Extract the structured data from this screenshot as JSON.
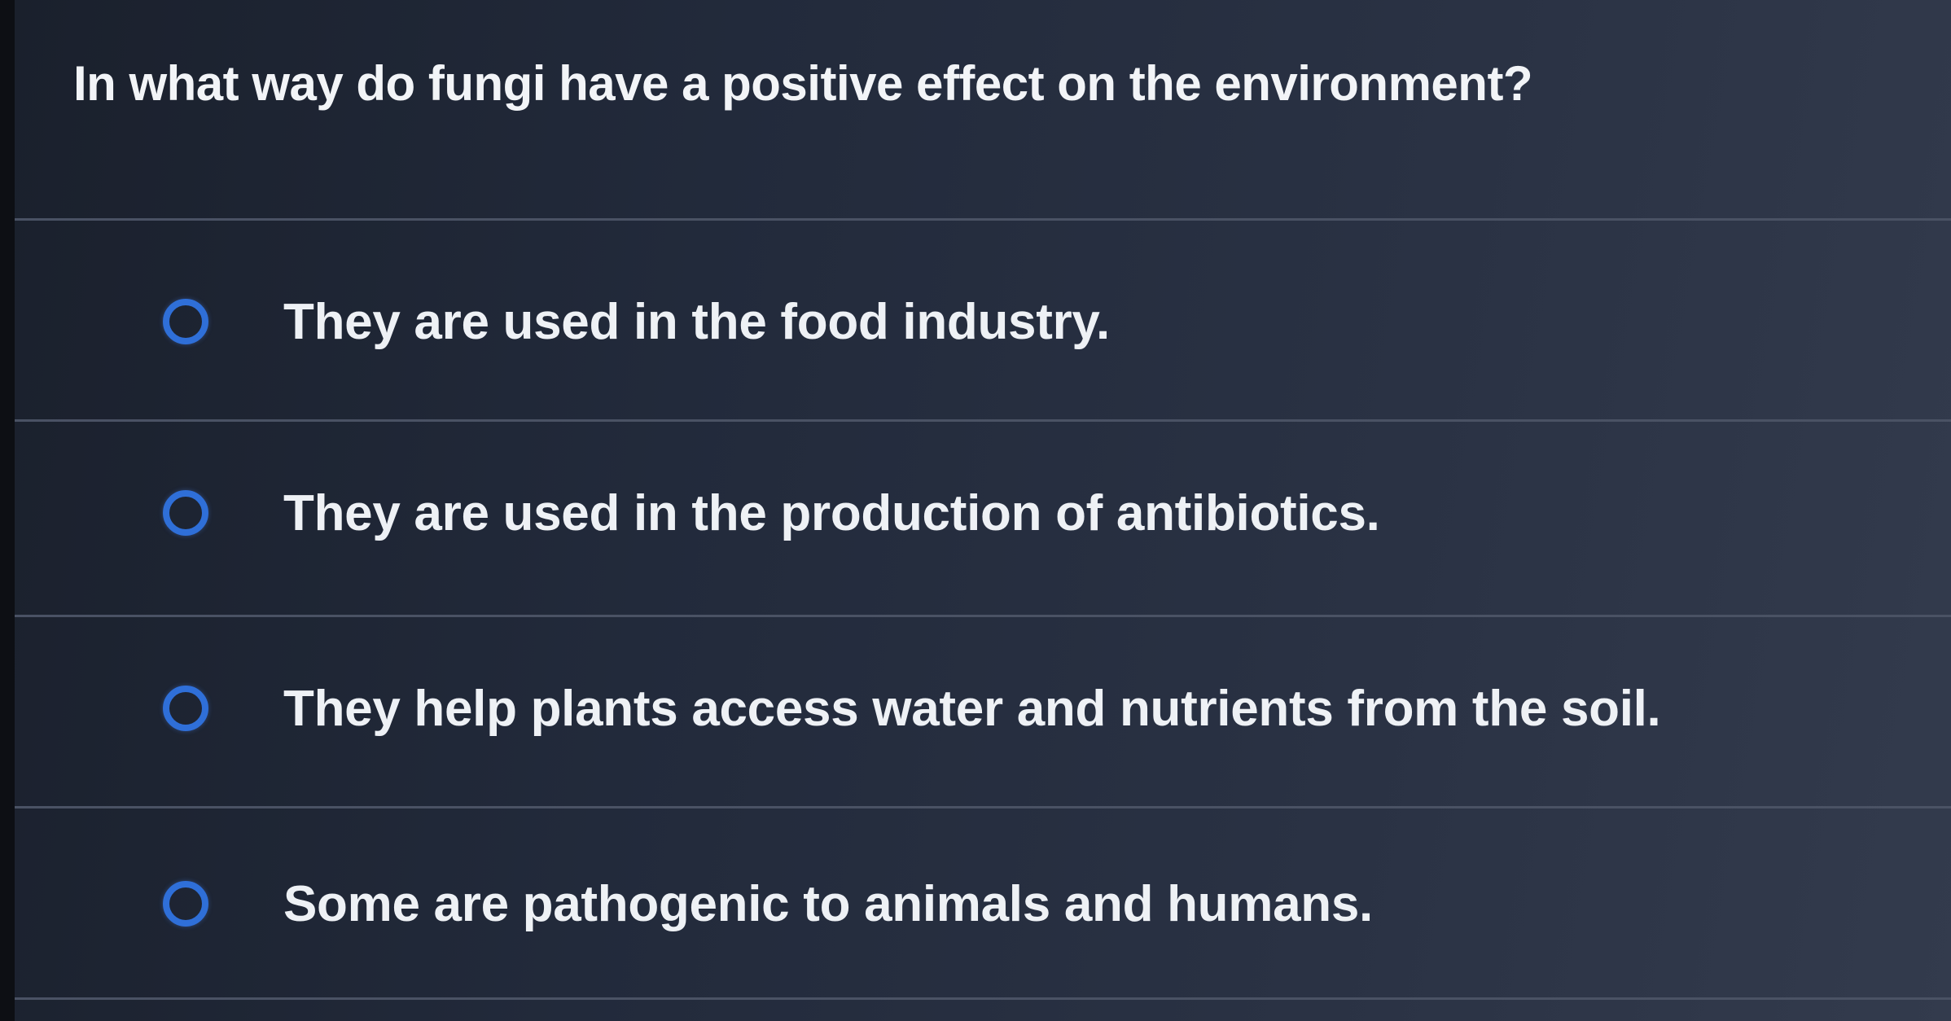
{
  "quiz": {
    "question": "In what way do fungi have a positive effect on the environment?",
    "options": [
      {
        "label": "They are used in the food industry."
      },
      {
        "label": "They are used in the production of antibiotics."
      },
      {
        "label": "They help plants access water and nutrients from the soil."
      },
      {
        "label": "Some are pathogenic to animals and humans."
      }
    ]
  },
  "colors": {
    "background": "#222a3b",
    "radio_ring": "#2f6fd8",
    "text": "#eef1f5"
  }
}
